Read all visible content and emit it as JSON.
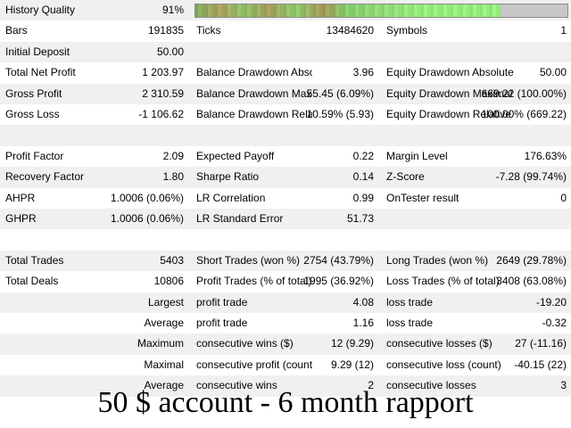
{
  "history_quality": {
    "label": "History Quality",
    "value": "91%",
    "fill_fraction": 0.82
  },
  "rows": [
    {
      "shade": true,
      "cells": [
        "History Quality",
        "91%",
        "",
        "",
        "",
        ""
      ]
    },
    {
      "shade": false,
      "cells": [
        "Bars",
        "191835",
        "Ticks",
        "13484620",
        "Symbols",
        "1"
      ]
    },
    {
      "shade": true,
      "cells": [
        "Initial Deposit",
        "50.00",
        "",
        "",
        "",
        ""
      ]
    },
    {
      "shade": false,
      "cells": [
        "Total Net Profit",
        "1 203.97",
        "Balance Drawdown Absol...",
        "3.96",
        "Equity Drawdown Absolute",
        "50.00"
      ]
    },
    {
      "shade": true,
      "cells": [
        "Gross Profit",
        "2 310.59",
        "Balance Drawdown Maxi...",
        "55.45 (6.09%)",
        "Equity Drawdown Maximal",
        "669.22 (100.00%)"
      ]
    },
    {
      "shade": false,
      "cells": [
        "Gross Loss",
        "-1 106.62",
        "Balance Drawdown Relati...",
        "10.59% (5.93)",
        "Equity Drawdown Relative",
        "100.00% (669.22)"
      ]
    },
    {
      "shade": true,
      "cells": [
        "",
        "",
        "",
        "",
        "",
        ""
      ]
    },
    {
      "shade": false,
      "cells": [
        "Profit Factor",
        "2.09",
        "Expected Payoff",
        "0.22",
        "Margin Level",
        "176.63%"
      ]
    },
    {
      "shade": true,
      "cells": [
        "Recovery Factor",
        "1.80",
        "Sharpe Ratio",
        "0.14",
        "Z-Score",
        "-7.28 (99.74%)"
      ]
    },
    {
      "shade": false,
      "cells": [
        "AHPR",
        "1.0006 (0.06%)",
        "LR Correlation",
        "0.99",
        "OnTester result",
        "0"
      ]
    },
    {
      "shade": true,
      "cells": [
        "GHPR",
        "1.0006 (0.06%)",
        "LR Standard Error",
        "51.73",
        "",
        ""
      ]
    },
    {
      "shade": false,
      "cells": [
        "",
        "",
        "",
        "",
        "",
        ""
      ]
    },
    {
      "shade": true,
      "cells": [
        "Total Trades",
        "5403",
        "Short Trades (won %)",
        "2754 (43.79%)",
        "Long Trades (won %)",
        "2649 (29.78%)"
      ]
    },
    {
      "shade": false,
      "cells": [
        "Total Deals",
        "10806",
        "Profit Trades (% of total)",
        "1995 (36.92%)",
        "Loss Trades (% of total)",
        "3408 (63.08%)"
      ]
    },
    {
      "shade": true,
      "cells": [
        "",
        "Largest",
        "profit trade",
        "4.08",
        "loss trade",
        "-19.20"
      ],
      "right_label": true
    },
    {
      "shade": false,
      "cells": [
        "",
        "Average",
        "profit trade",
        "1.16",
        "loss trade",
        "-0.32"
      ],
      "right_label": true
    },
    {
      "shade": true,
      "cells": [
        "",
        "Maximum",
        "consecutive wins ($)",
        "12 (9.29)",
        "consecutive losses ($)",
        "27 (-11.16)"
      ],
      "right_label": true
    },
    {
      "shade": false,
      "cells": [
        "",
        "Maximal",
        "consecutive profit (count)",
        "9.29 (12)",
        "consecutive loss (count)",
        "-40.15 (22)"
      ],
      "right_label": true
    },
    {
      "shade": true,
      "cells": [
        "",
        "Average",
        "consecutive wins",
        "2",
        "consecutive losses",
        "3"
      ],
      "right_label": true
    },
    {
      "shade": false,
      "cells": [
        "",
        "",
        "",
        "",
        "",
        ""
      ]
    }
  ],
  "caption": "50 $ account - 6 month rapport"
}
